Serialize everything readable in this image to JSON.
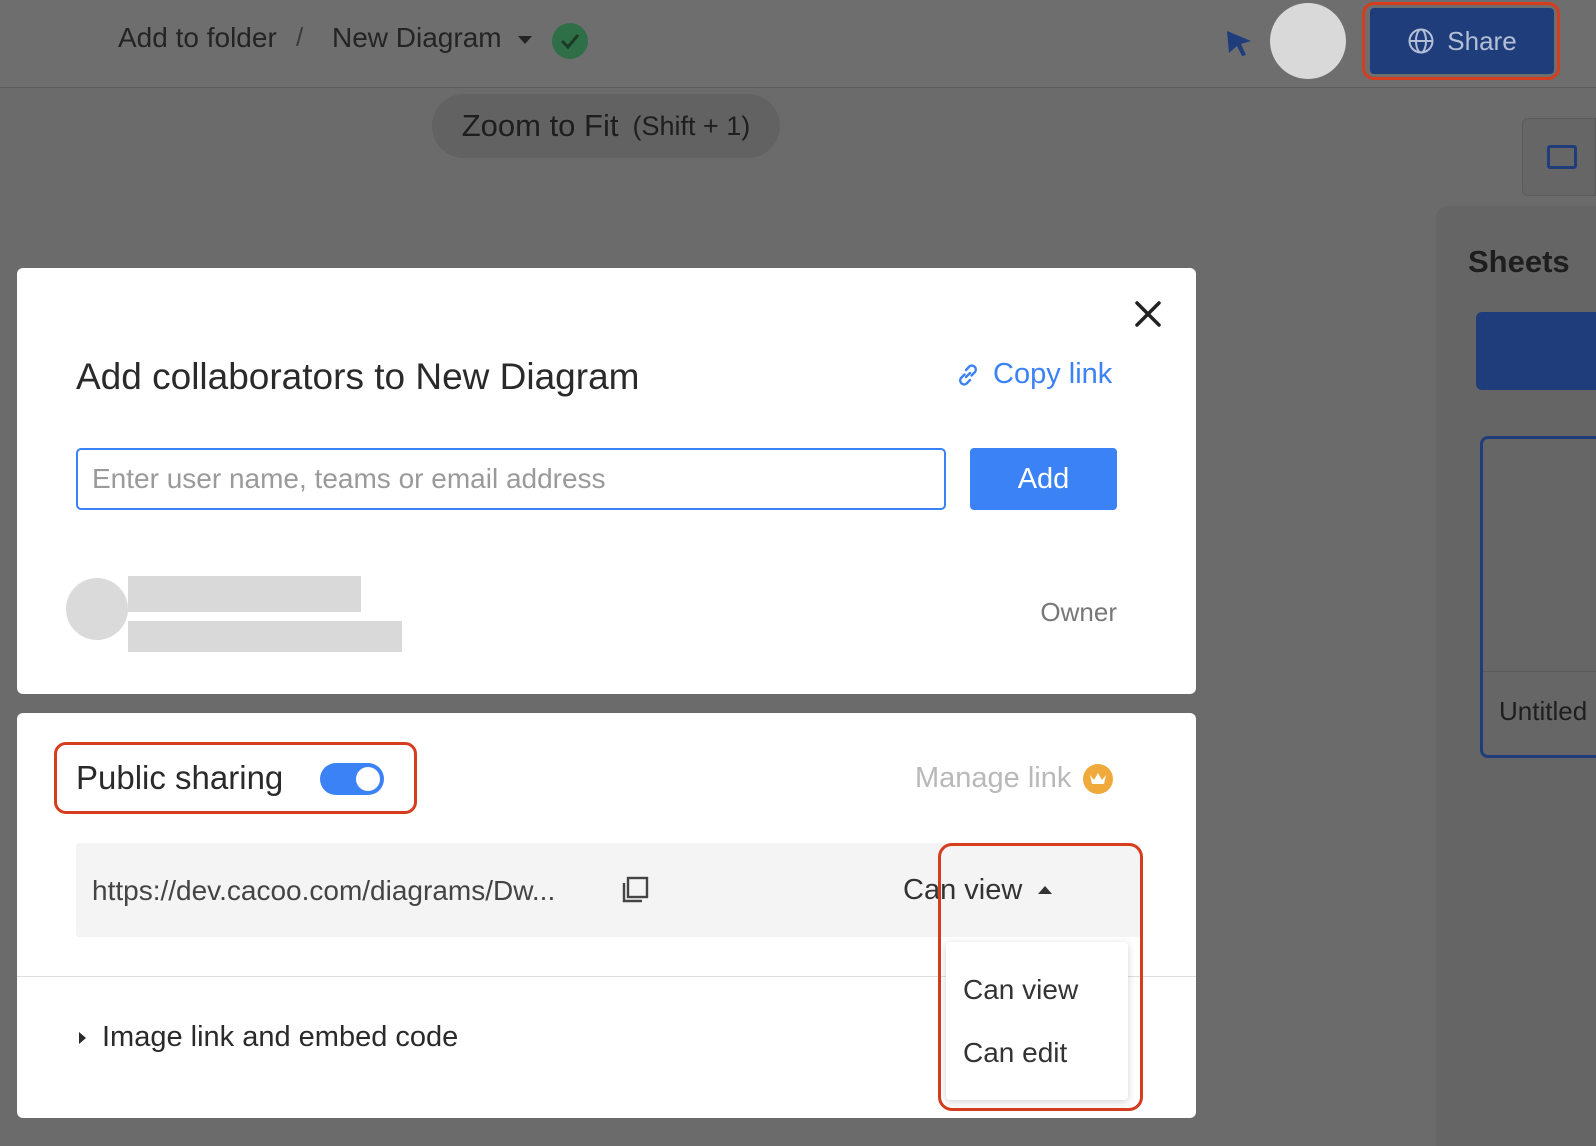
{
  "header": {
    "folder_link": "Add to folder",
    "separator": "/",
    "diagram_title": "New Diagram",
    "share_label": "Share",
    "icons": [
      "chevron-down-icon",
      "saved-check-icon",
      "pointer-icon",
      "globe-icon"
    ]
  },
  "canvas": {
    "zoom_tooltip_label": "Zoom to Fit",
    "zoom_tooltip_shortcut": "(Shift + 1)",
    "sheets_title": "Sheets",
    "sheet_name": "Untitled"
  },
  "dialog": {
    "title": "Add collaborators to New Diagram",
    "copy_link_label": "Copy link",
    "invite_placeholder": "Enter user name, teams or email address",
    "invite_value": "",
    "add_label": "Add",
    "member_role": "Owner",
    "public_sharing_label": "Public sharing",
    "public_sharing_enabled": true,
    "manage_link_label": "Manage link",
    "share_url": "https://dev.cacoo.com/diagrams/Dw...",
    "permission_selected": "Can view",
    "permission_options": [
      "Can view",
      "Can edit"
    ],
    "embed_label": "Image link and embed code"
  },
  "colors": {
    "accent": "#3b82f6",
    "highlight": "#d63c1e",
    "overlay": "#6b6b6b",
    "premium": "#f0a93b"
  }
}
